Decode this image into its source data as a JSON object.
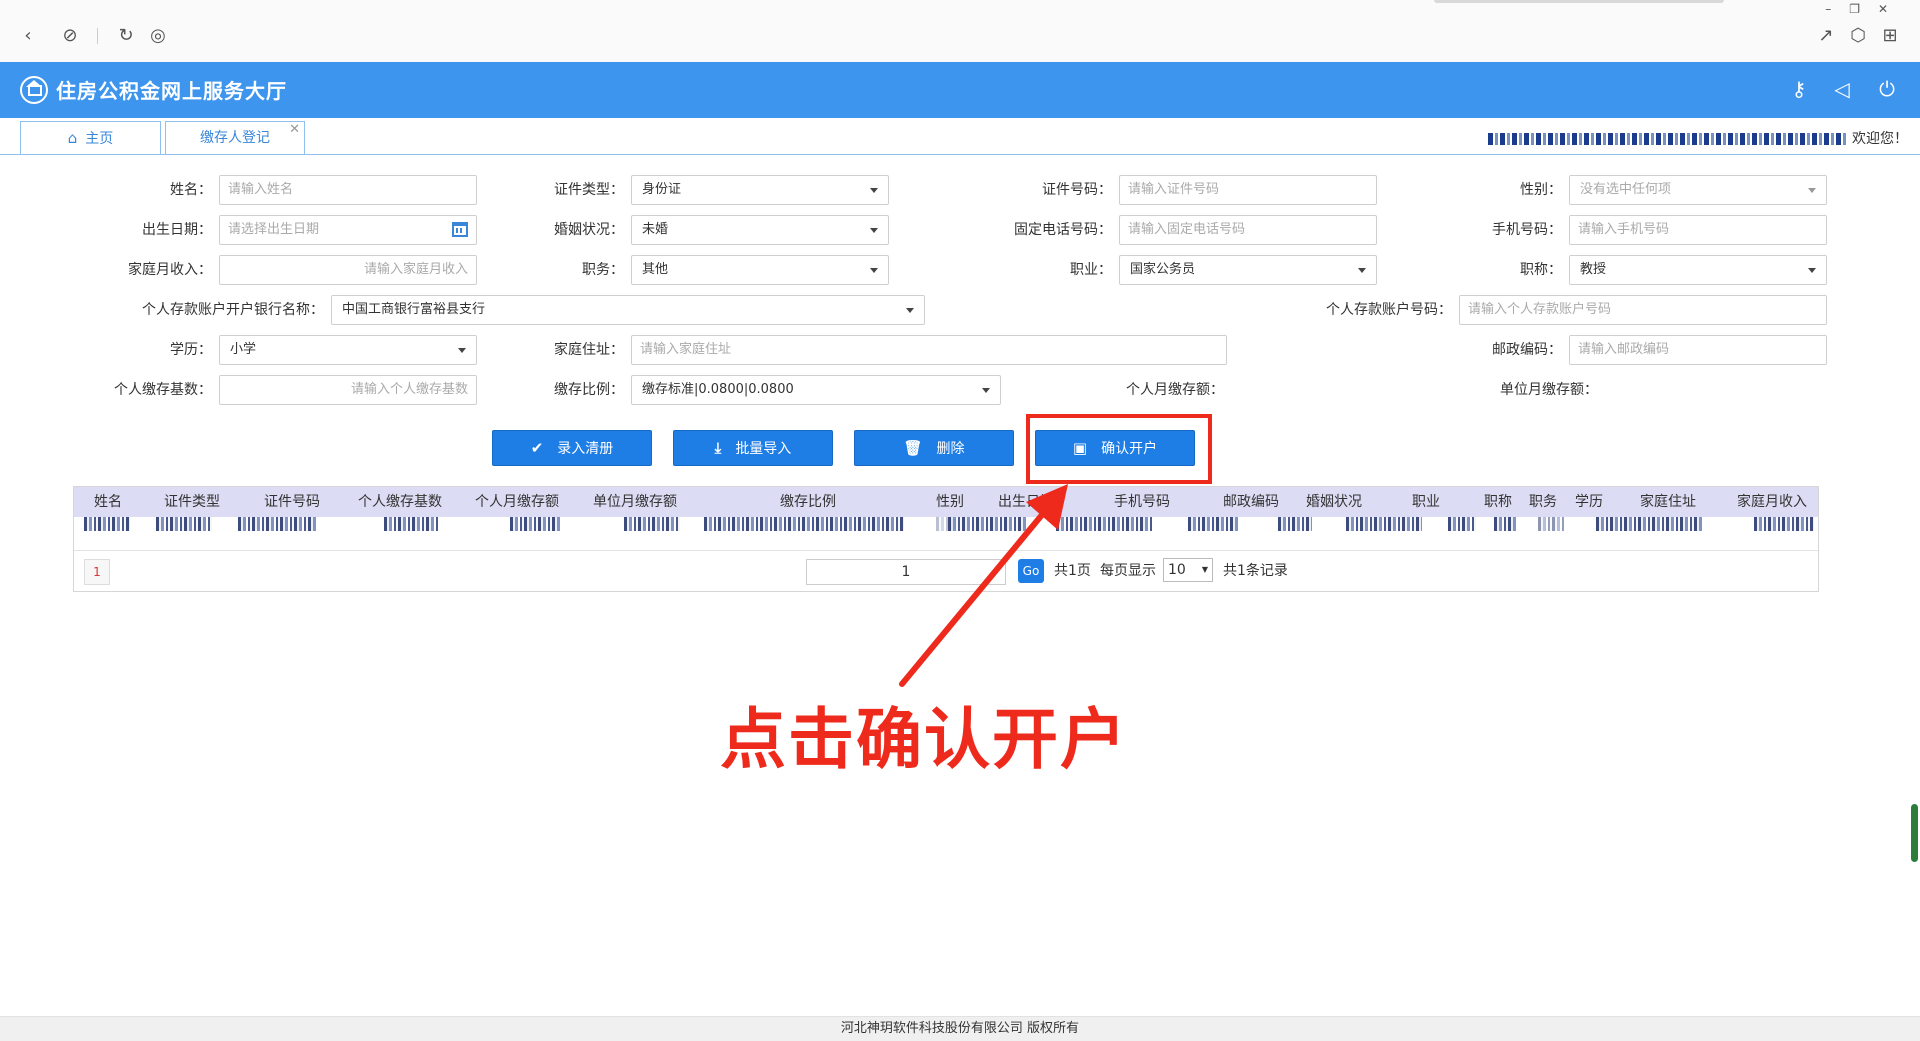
{
  "browser": {
    "back_icon": "back-arrow-icon",
    "link_icon": "link-icon",
    "reload_icon": "reload-icon",
    "globe_icon": "globe-icon",
    "share_icon": "share-icon",
    "cube_icon": "cube-icon",
    "extension_icon": "extension-icon"
  },
  "header": {
    "title": "住房公积金网上服务大厅",
    "color": "#3e95ee"
  },
  "tabs": [
    {
      "label": "主页"
    },
    {
      "label": "缴存人登记"
    }
  ],
  "user": {
    "welcome": "欢迎您！"
  },
  "form": {
    "name_label": "姓名：",
    "name_ph": "请输入姓名",
    "idtype_label": "证件类型：",
    "idtype_value": "身份证",
    "idno_label": "证件号码：",
    "idno_ph": "请输入证件号码",
    "gender_label": "性别：",
    "gender_value": "没有选中任何项",
    "birth_label": "出生日期：",
    "birth_ph": "请选择出生日期",
    "marital_label": "婚姻状况：",
    "marital_value": "未婚",
    "phone_label": "固定电话号码：",
    "phone_ph": "请输入固定电话号码",
    "mobile_label": "手机号码：",
    "mobile_ph": "请输入手机号码",
    "income_label": "家庭月收入：",
    "income_ph": "请输入家庭月收入",
    "duty_label": "职务：",
    "duty_value": "其他",
    "job_label": "职业：",
    "job_value": "国家公务员",
    "title_label": "职称：",
    "title_value": "教授",
    "bank_label": "个人存款账户开户银行名称：",
    "bank_value": "中国工商银行富裕县支行",
    "account_label": "个人存款账户号码：",
    "account_ph": "请输入个人存款账户号码",
    "edu_label": "学历：",
    "edu_value": "小学",
    "address_label": "家庭住址：",
    "address_ph": "请输入家庭住址",
    "zip_label": "邮政编码：",
    "zip_ph": "请输入邮政编码",
    "base_label": "个人缴存基数：",
    "base_ph": "请输入个人缴存基数",
    "ratio_label": "缴存比例：",
    "ratio_value": "缴存标准|0.0800|0.0800",
    "personal_monthly_label": "个人月缴存额：",
    "unit_monthly_label": "单位月缴存额："
  },
  "buttons": {
    "register_list": "录入清册",
    "batch_import": "批量导入",
    "delete": "删除",
    "confirm_open": "确认开户"
  },
  "table": {
    "columns": [
      "姓名",
      "证件类型",
      "证件号码",
      "个人缴存基数",
      "个人月缴存额",
      "单位月缴存额",
      "缴存比例",
      "性别",
      "出生日期",
      "手机号码",
      "邮政编码",
      "婚姻状况",
      "职业",
      "职称",
      "职务",
      "学历",
      "家庭住址",
      "家庭月收入"
    ],
    "header_color": "#dcdcf4"
  },
  "pager": {
    "current_page": "1",
    "page_input": "1",
    "go": "Go",
    "total_pages": "共1页",
    "per_page_label": "每页显示",
    "per_page": "10",
    "total_records": "共1条记录"
  },
  "annotation": {
    "text": "点击确认开户",
    "color": "#ee2a1d"
  },
  "footer": {
    "copyright": "河北神玥软件科技股份有限公司 版权所有"
  }
}
